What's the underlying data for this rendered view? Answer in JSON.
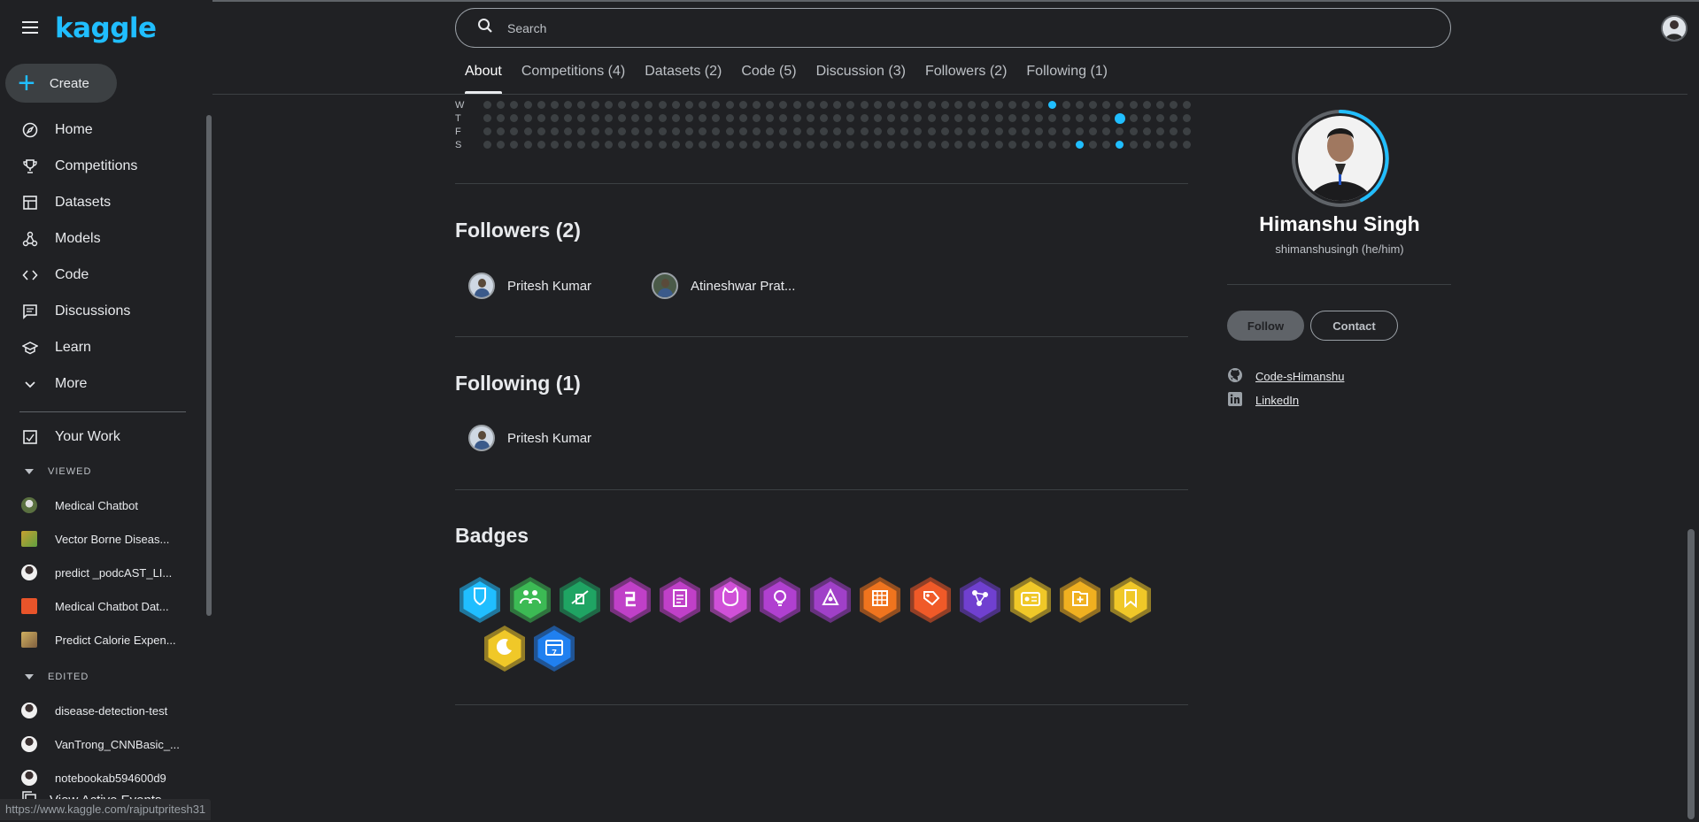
{
  "sidebar": {
    "logo": "kaggle",
    "create_label": "Create",
    "nav": [
      {
        "label": "Home",
        "icon": "compass-icon"
      },
      {
        "label": "Competitions",
        "icon": "trophy-icon"
      },
      {
        "label": "Datasets",
        "icon": "table-icon"
      },
      {
        "label": "Models",
        "icon": "models-icon"
      },
      {
        "label": "Code",
        "icon": "code-icon"
      },
      {
        "label": "Discussions",
        "icon": "comment-icon"
      },
      {
        "label": "Learn",
        "icon": "school-icon"
      },
      {
        "label": "More",
        "icon": "chevron-down-icon"
      }
    ],
    "your_work": "Your Work",
    "viewed_label": "VIEWED",
    "viewed": [
      "Medical Chatbot",
      "Vector Borne Diseas...",
      "predict _podcAST_LI...",
      "Medical Chatbot Dat...",
      "Predict Calorie Expen..."
    ],
    "edited_label": "EDITED",
    "edited": [
      "disease-detection-test",
      "VanTrong_CNNBasic_...",
      "notebookab594600d9"
    ],
    "view_events": "View Active Events",
    "status_url": "https://www.kaggle.com/rajputpritesh31"
  },
  "header": {
    "search_placeholder": "Search",
    "tabs": [
      {
        "label": "About",
        "active": true
      },
      {
        "label": "Competitions (4)"
      },
      {
        "label": "Datasets (2)"
      },
      {
        "label": "Code (5)"
      },
      {
        "label": "Discussion (3)"
      },
      {
        "label": "Followers (2)"
      },
      {
        "label": "Following (1)"
      }
    ]
  },
  "activity": {
    "day_labels": [
      "W",
      "T",
      "F",
      "S"
    ],
    "accent": "#20beff"
  },
  "followers": {
    "title": "Followers (2)",
    "people": [
      "Pritesh Kumar",
      "Atineshwar Prat..."
    ]
  },
  "following": {
    "title": "Following (1)",
    "people": [
      "Pritesh Kumar"
    ]
  },
  "badges": {
    "title": "Badges",
    "items": [
      {
        "name": "shield-badge",
        "color": "#20beff"
      },
      {
        "name": "community-badge",
        "color": "#3cba54"
      },
      {
        "name": "notebook-badge",
        "color": "#1fa463"
      },
      {
        "name": "python-badge",
        "color": "#c040c8"
      },
      {
        "name": "document-badge",
        "color": "#c040c8"
      },
      {
        "name": "cat-badge",
        "color": "#d050d8"
      },
      {
        "name": "bulb-badge",
        "color": "#b040d0"
      },
      {
        "name": "network-badge",
        "color": "#a040c8"
      },
      {
        "name": "dataset-badge",
        "color": "#f0741e"
      },
      {
        "name": "tag-badge",
        "color": "#f05a28"
      },
      {
        "name": "graph-badge",
        "color": "#7040d0"
      },
      {
        "name": "id-card-badge",
        "color": "#f0c828"
      },
      {
        "name": "folder-badge",
        "color": "#f0b020"
      },
      {
        "name": "bookmark-badge",
        "color": "#f0c828"
      },
      {
        "name": "moon-badge",
        "color": "#f0c828"
      },
      {
        "name": "calendar-badge",
        "color": "#2080f0"
      }
    ],
    "calendar_day": "7"
  },
  "profile": {
    "name": "Himanshu Singh",
    "handle": "shimanshusingh (he/him)",
    "follow_label": "Follow",
    "contact_label": "Contact",
    "github": "Code-sHimanshu",
    "linkedin": "LinkedIn",
    "ring_color": "#20beff"
  }
}
